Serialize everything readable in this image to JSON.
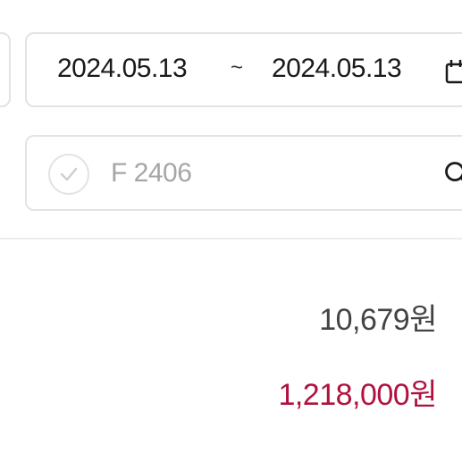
{
  "date_range": {
    "start": "2024.05.13",
    "separator": "~",
    "end": "2024.05.13"
  },
  "search": {
    "placeholder": "F 2406",
    "value": ""
  },
  "amounts": {
    "first": "10,679원",
    "second": "1,218,000원"
  },
  "colors": {
    "accent": "#b0123f",
    "border": "#e3e3e3",
    "placeholder": "#a6a6a6"
  },
  "icons": [
    "calendar-icon",
    "checkmark-icon",
    "search-icon"
  ]
}
